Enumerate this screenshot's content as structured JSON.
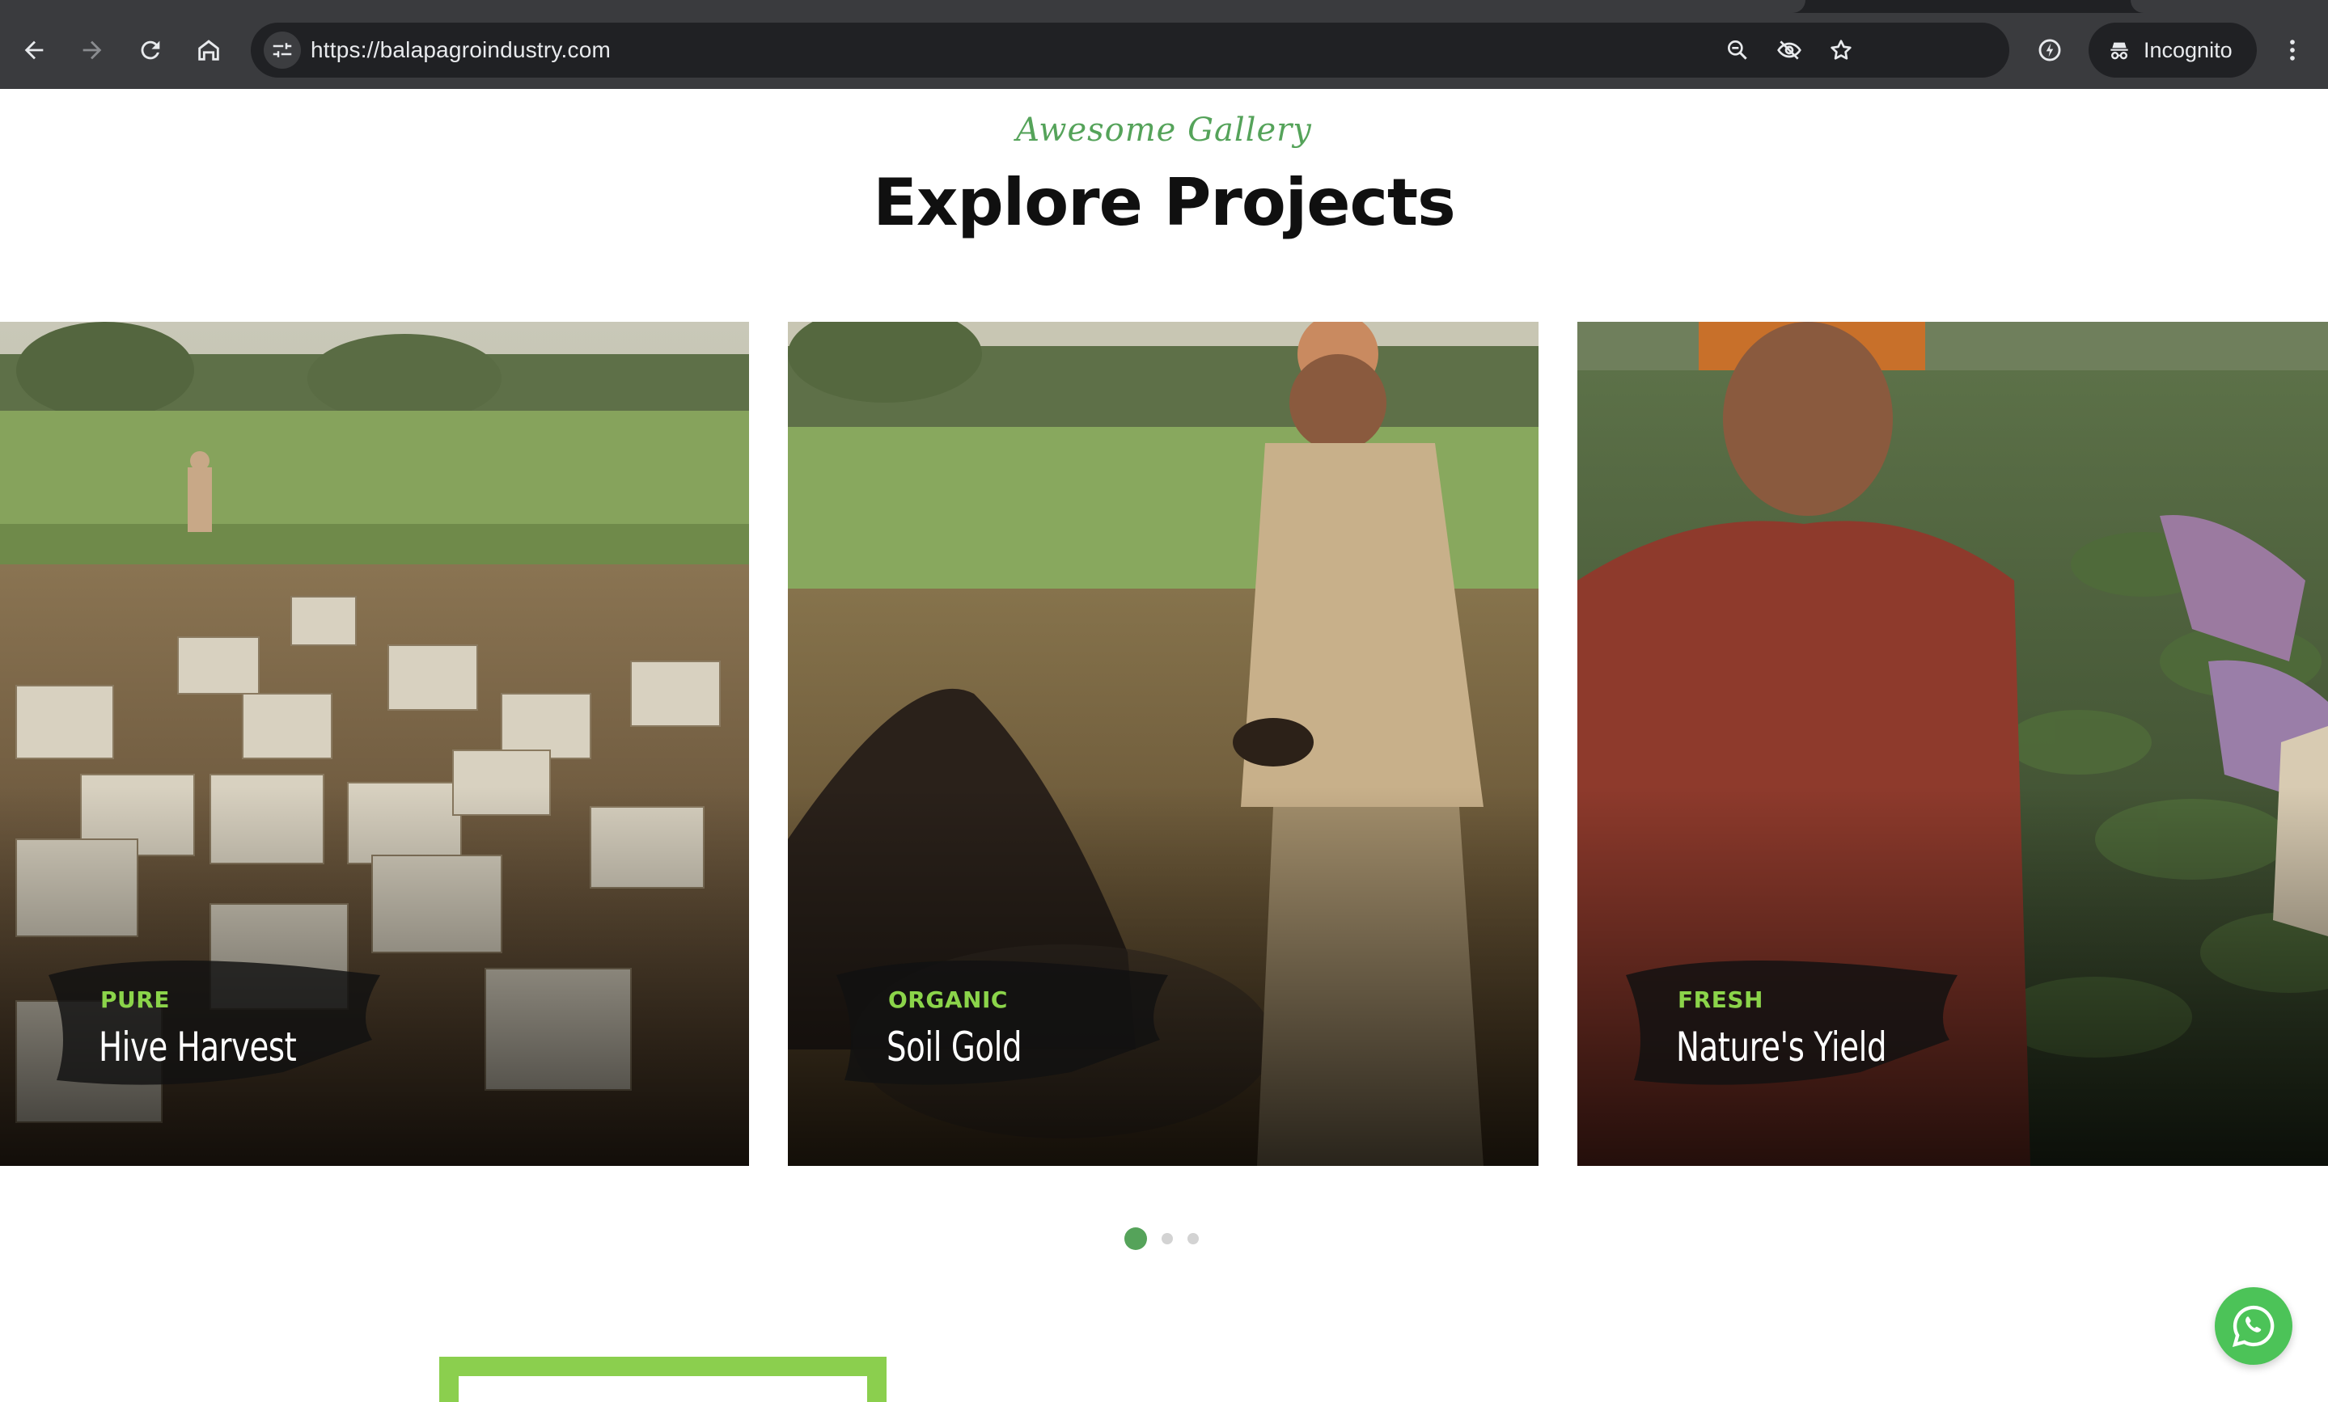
{
  "browser": {
    "url": "https://balapagroindustry.com",
    "incognito_label": "Incognito",
    "icons": [
      "back-icon",
      "forward-icon",
      "reload-icon",
      "home-icon",
      "site-settings-icon",
      "zoom-icon",
      "eye-off-icon",
      "star-icon",
      "extension-icon",
      "incognito-icon",
      "menu-icon"
    ]
  },
  "section": {
    "eyebrow": "Awesome Gallery",
    "heading": "Explore Projects"
  },
  "cards": [
    {
      "tag": "PURE",
      "title": "Hive Harvest",
      "scene": "bee boxes in a field"
    },
    {
      "tag": "ORGANIC",
      "title": "Soil Gold",
      "scene": "farmer holding compost"
    },
    {
      "tag": "FRESH",
      "title": "Nature's Yield",
      "scene": "farmer in a crop field"
    }
  ],
  "pagination": {
    "active": 0,
    "count": 3
  },
  "colors": {
    "accent_green": "#55a35a",
    "tag_green": "#8bd44a",
    "whatsapp_green": "#4cc358",
    "frame_green": "#8bcf4e"
  }
}
